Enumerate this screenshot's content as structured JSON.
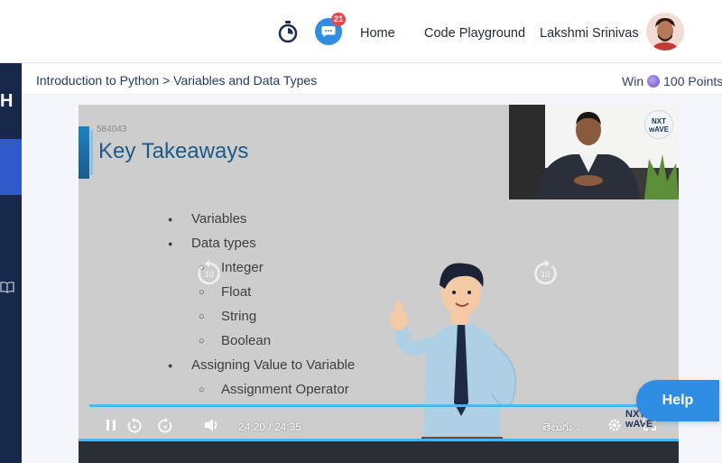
{
  "header": {
    "notification_count": "21",
    "nav_home": "Home",
    "nav_code_playground": "Code Playground",
    "user_name": "Lakshmi Srinivas"
  },
  "sidebar": {
    "logo_text": "H"
  },
  "breadcrumb": {
    "course": "Introduction to Python",
    "separator": ">",
    "topic": "Variables and Data Types"
  },
  "reward": {
    "prefix": "Win",
    "points": "100 Points"
  },
  "video": {
    "slide_code": "584043",
    "slide_title": "Key Takeaways",
    "bullets": [
      {
        "level": 1,
        "text": "Variables"
      },
      {
        "level": 1,
        "text": "Data types"
      },
      {
        "level": 2,
        "text": "Integer"
      },
      {
        "level": 2,
        "text": "Float"
      },
      {
        "level": 2,
        "text": "String"
      },
      {
        "level": 2,
        "text": "Boolean"
      },
      {
        "level": 1,
        "text": "Assigning Value to Variable"
      },
      {
        "level": 2,
        "text": "Assignment Operator"
      }
    ],
    "skip_seconds": "10",
    "current_time": "24:20",
    "time_separator": "/",
    "duration": "24:35",
    "progress_fraction": 0.99,
    "caption_language": "తెలుగు",
    "brand_badge": "NXT wAVE"
  },
  "help_button": "Help",
  "colors": {
    "accent_blue": "#2f8de4",
    "sidebar_bg": "#17284a",
    "sidebar_active": "#2f59c8",
    "progress": "#49b6f5",
    "badge_red": "#e5484d"
  }
}
